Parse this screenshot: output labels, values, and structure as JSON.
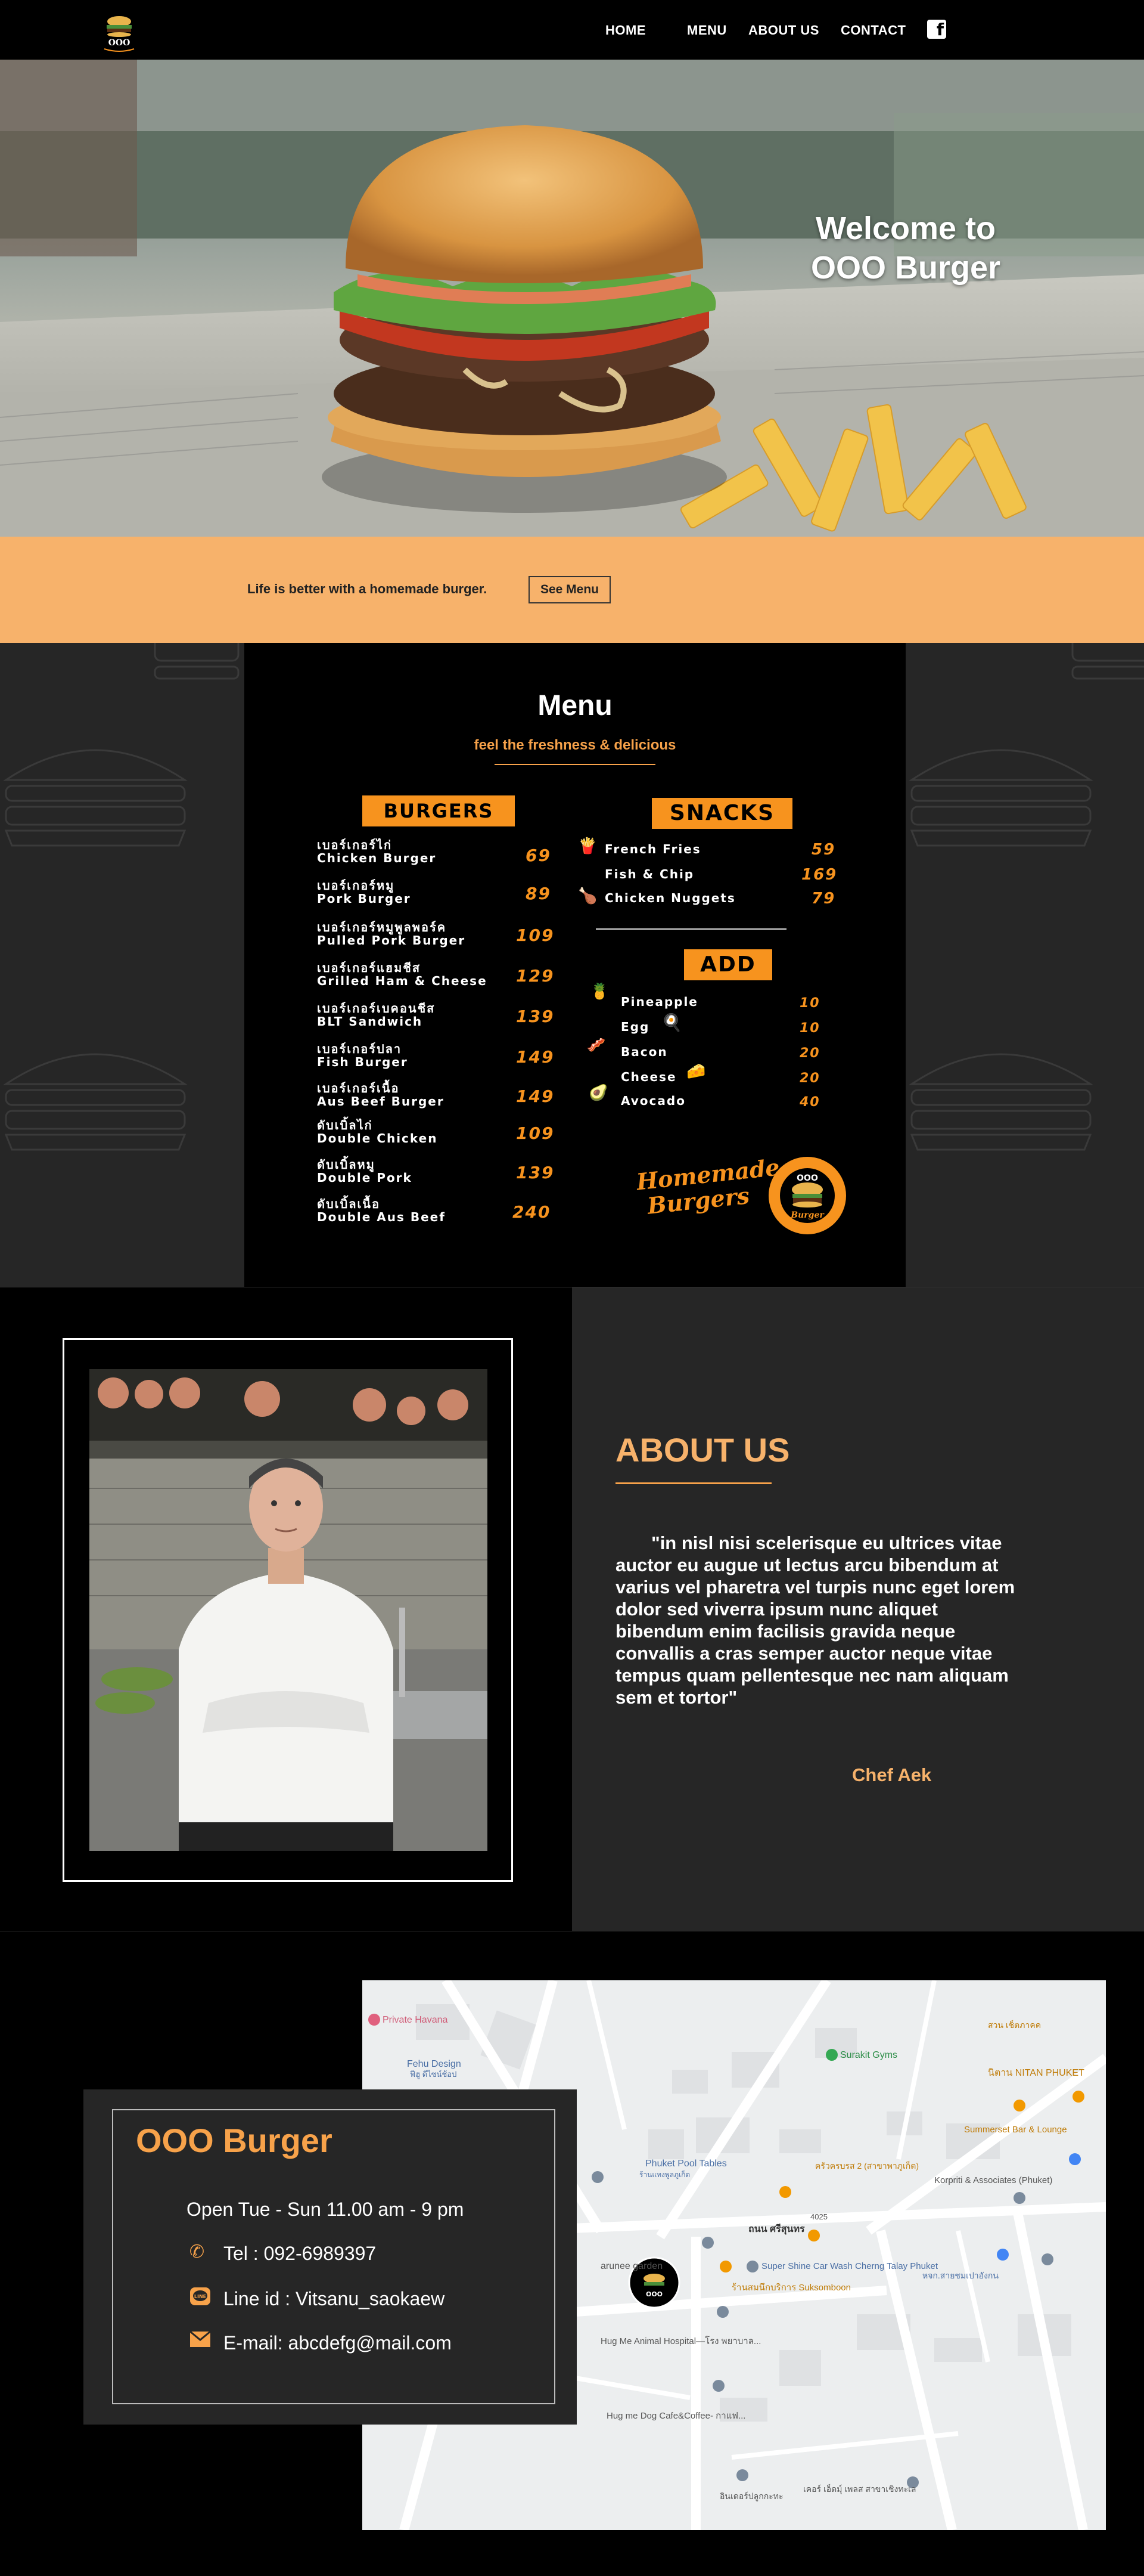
{
  "nav": {
    "items": [
      {
        "label": "HOME"
      },
      {
        "label": "MENU"
      },
      {
        "label": "ABOUT US"
      },
      {
        "label": "CONTACT"
      }
    ],
    "facebook_icon": "facebook-icon"
  },
  "hero": {
    "title_line1": "Welcome to",
    "title_line2": "OOO Burger"
  },
  "tagline": {
    "text": "Life is better with a homemade burger.",
    "button_label": "See Menu"
  },
  "menu": {
    "title": "Menu",
    "subtitle": "feel the freshness & delicious",
    "burgers_label": "BURGERS",
    "burgers": [
      {
        "th": "เบอร์เกอร์ไก่",
        "en": "Chicken Burger",
        "price": "69"
      },
      {
        "th": "เบอร์เกอร์หมู",
        "en": "Pork Burger",
        "price": "89"
      },
      {
        "th": "เบอร์เกอร์หมูพูลพอร์ค",
        "en": "Pulled Pork Burger",
        "price": "109"
      },
      {
        "th": "เบอร์เกอร์แฮมชีส",
        "en": "Grilled Ham & Cheese",
        "price": "129"
      },
      {
        "th": "เบอร์เกอร์เบคอนชีส",
        "en": "BLT Sandwich",
        "price": "139"
      },
      {
        "th": "เบอร์เกอร์ปลา",
        "en": "Fish Burger",
        "price": "149"
      },
      {
        "th": "เบอร์เกอร์เนื้อ",
        "en": "Aus Beef Burger",
        "price": "149"
      },
      {
        "th": "ดับเบิ้ลไก่",
        "en": "Double Chicken",
        "price": "109"
      },
      {
        "th": "ดับเบิ้ลหมู",
        "en": "Double Pork",
        "price": "139"
      },
      {
        "th": "ดับเบิ้ลเนื้อ",
        "en": "Double Aus Beef",
        "price": "240"
      }
    ],
    "snacks_label": "SNACKS",
    "snacks": [
      {
        "name": "French Fries",
        "price": "59"
      },
      {
        "name": "Fish & Chip",
        "price": "169"
      },
      {
        "name": "Chicken Nuggets",
        "price": "79"
      }
    ],
    "add_label": "ADD",
    "adds": [
      {
        "name": "Pineapple",
        "price": "10"
      },
      {
        "name": "Egg",
        "price": "10"
      },
      {
        "name": "Bacon",
        "price": "20"
      },
      {
        "name": "Cheese",
        "price": "20"
      },
      {
        "name": "Avocado",
        "price": "40"
      }
    ],
    "homemade_line1": "Homemade",
    "homemade_line2": "Burgers",
    "badge_text": "OOO Burger"
  },
  "about": {
    "title": "ABOUT US",
    "quote": "\"in nisl nisi scelerisque eu ultrices vitae auctor eu augue ut lectus arcu bibendum at varius vel pharetra vel turpis nunc eget lorem dolor sed viverra ipsum nunc aliquet bibendum enim facilisis gravida neque convallis a cras semper auctor neque vitae tempus quam pellentesque nec nam aliquam sem et tortor\"",
    "signature": "Chef Aek"
  },
  "contact": {
    "title": "OOO Burger",
    "hours": "Open Tue - Sun 11.00 am - 9 pm",
    "tel": "Tel : 092-6989397",
    "line": "Line id : Vitsanu_saokaew",
    "email": "E-mail: abcdefg@mail.com"
  },
  "map": {
    "labels": [
      "Private Havana",
      "Fehu Design",
      "ฟีฮู ดีไซน์ช้อป",
      "Surakit Gyms",
      "สวน เช็ตภาคค",
      "นิตาน NITAN PHUKET",
      "Summerset Bar & Lounge",
      "Phuket Pool Tables",
      "ร้านแทงพูลภูเก็ต",
      "ครัวครบรส 2 (สาขาพาภูเก็ต)",
      "Korpriti & Associates (Phuket)",
      "ถนน ศรีสุนทร",
      "4025",
      "arunee garden",
      "Super Shine Car Wash Cherng Talay Phuket",
      "ร้านสมนึกบริการ Suksomboon",
      "หจก.สายชมเปาอังกน",
      "Hug Me Animal Hospital—โรง พยาบาล...",
      "Hug me Dog Cafe&Coffee- กาแฟ...",
      "อินเดอร์ปลูกกะทะ",
      "เคอร์ เอ็ดมุ์ เพลส สาขาเชิงทะเล"
    ]
  }
}
